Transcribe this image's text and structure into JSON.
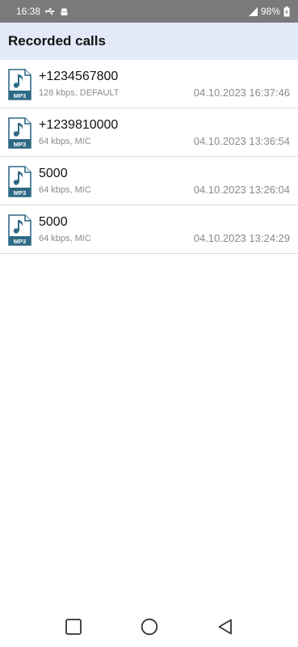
{
  "status_bar": {
    "time": "16:38",
    "battery": "98%"
  },
  "app_bar": {
    "title": "Recorded calls"
  },
  "file_icon_label": "MP3",
  "calls": [
    {
      "number": "+1234567800",
      "meta": "128 kbps, DEFAULT",
      "date": "04.10.2023 16:37:46"
    },
    {
      "number": "+1239810000",
      "meta": "64 kbps, MIC",
      "date": "04.10.2023 13:36:54"
    },
    {
      "number": "5000",
      "meta": "64 kbps, MIC",
      "date": "04.10.2023 13:26:04"
    },
    {
      "number": "5000",
      "meta": "64 kbps, MIC",
      "date": "04.10.2023 13:24:29"
    }
  ],
  "colors": {
    "status_bar_bg": "#7a7a7a",
    "app_bar_bg": "#e3e9f9",
    "file_icon_primary": "#2e6a85",
    "divider": "#dcdcdc"
  },
  "icons": {
    "status_left": [
      "usb-icon",
      "android-debug-icon"
    ],
    "status_right": [
      "signal-icon",
      "battery-charging-icon"
    ],
    "nav": [
      "recents-icon",
      "home-icon",
      "back-icon"
    ]
  }
}
